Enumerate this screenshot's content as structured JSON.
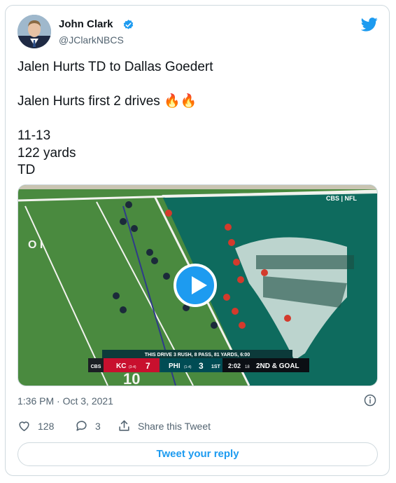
{
  "author": {
    "name": "John Clark",
    "handle": "@JClarkNBCS",
    "verified": true
  },
  "tweet": {
    "lines": [
      "Jalen Hurts TD to Dallas Goedert",
      "",
      "Jalen Hurts first 2 drives 🔥🔥",
      "",
      "11-13",
      "122 yards",
      "TD"
    ]
  },
  "video": {
    "network_logo": "CBS | NFL",
    "drive_banner": "THIS DRIVE   3 RUSH, 8 PASS, 81 YARDS, 6:00",
    "scoreboard": {
      "network": "CBS",
      "away_team": "KC",
      "away_record": "(3-4)",
      "away_score": "7",
      "home_team": "PHI",
      "home_record": "(1-4)",
      "home_score": "3",
      "quarter": "1ST",
      "clock": "2:02",
      "play_clock": "18",
      "down_distance": "2ND & GOAL"
    },
    "field_text": [
      "O I",
      "10"
    ]
  },
  "timestamp": "1:36 PM · Oct 3, 2021",
  "actions": {
    "likes": "128",
    "replies": "3",
    "share_label": "Share this Tweet"
  },
  "reply_button_label": "Tweet your reply",
  "colors": {
    "brand_blue": "#1d9bf0",
    "text_primary": "#0f1419",
    "text_secondary": "#536471",
    "border": "#cfd9de",
    "field_green": "#3f7a3a",
    "endzone_teal": "#0f6e5f"
  },
  "icons": [
    "verified-badge-icon",
    "twitter-bird-icon",
    "info-icon",
    "heart-icon",
    "reply-bubble-icon",
    "share-icon",
    "play-icon"
  ]
}
